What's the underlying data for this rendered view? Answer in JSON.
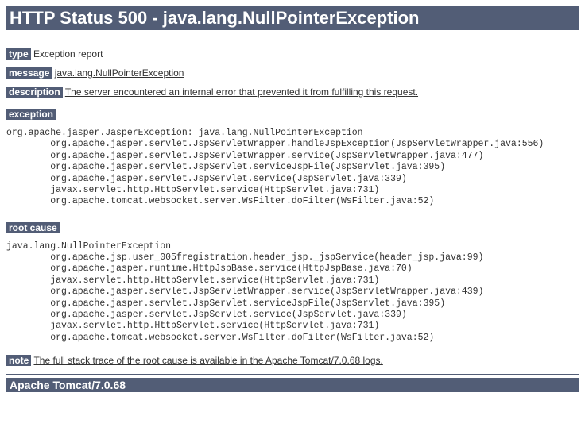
{
  "title": "HTTP Status 500 - java.lang.NullPointerException",
  "labels": {
    "type": "type",
    "message": "message",
    "description": "description",
    "exception": "exception",
    "root_cause": "root cause",
    "note": "note"
  },
  "values": {
    "type": "Exception report",
    "message": "java.lang.NullPointerException",
    "description": "The server encountered an internal error that prevented it from fulfilling this request.",
    "note": "The full stack trace of the root cause is available in the Apache Tomcat/7.0.68 logs."
  },
  "exception_trace": "org.apache.jasper.JasperException: java.lang.NullPointerException\n\torg.apache.jasper.servlet.JspServletWrapper.handleJspException(JspServletWrapper.java:556)\n\torg.apache.jasper.servlet.JspServletWrapper.service(JspServletWrapper.java:477)\n\torg.apache.jasper.servlet.JspServlet.serviceJspFile(JspServlet.java:395)\n\torg.apache.jasper.servlet.JspServlet.service(JspServlet.java:339)\n\tjavax.servlet.http.HttpServlet.service(HttpServlet.java:731)\n\torg.apache.tomcat.websocket.server.WsFilter.doFilter(WsFilter.java:52)",
  "root_cause_trace": "java.lang.NullPointerException\n\torg.apache.jsp.user_005fregistration.header_jsp._jspService(header_jsp.java:99)\n\torg.apache.jasper.runtime.HttpJspBase.service(HttpJspBase.java:70)\n\tjavax.servlet.http.HttpServlet.service(HttpServlet.java:731)\n\torg.apache.jasper.servlet.JspServletWrapper.service(JspServletWrapper.java:439)\n\torg.apache.jasper.servlet.JspServlet.serviceJspFile(JspServlet.java:395)\n\torg.apache.jasper.servlet.JspServlet.service(JspServlet.java:339)\n\tjavax.servlet.http.HttpServlet.service(HttpServlet.java:731)\n\torg.apache.tomcat.websocket.server.WsFilter.doFilter(WsFilter.java:52)",
  "footer": "Apache Tomcat/7.0.68"
}
